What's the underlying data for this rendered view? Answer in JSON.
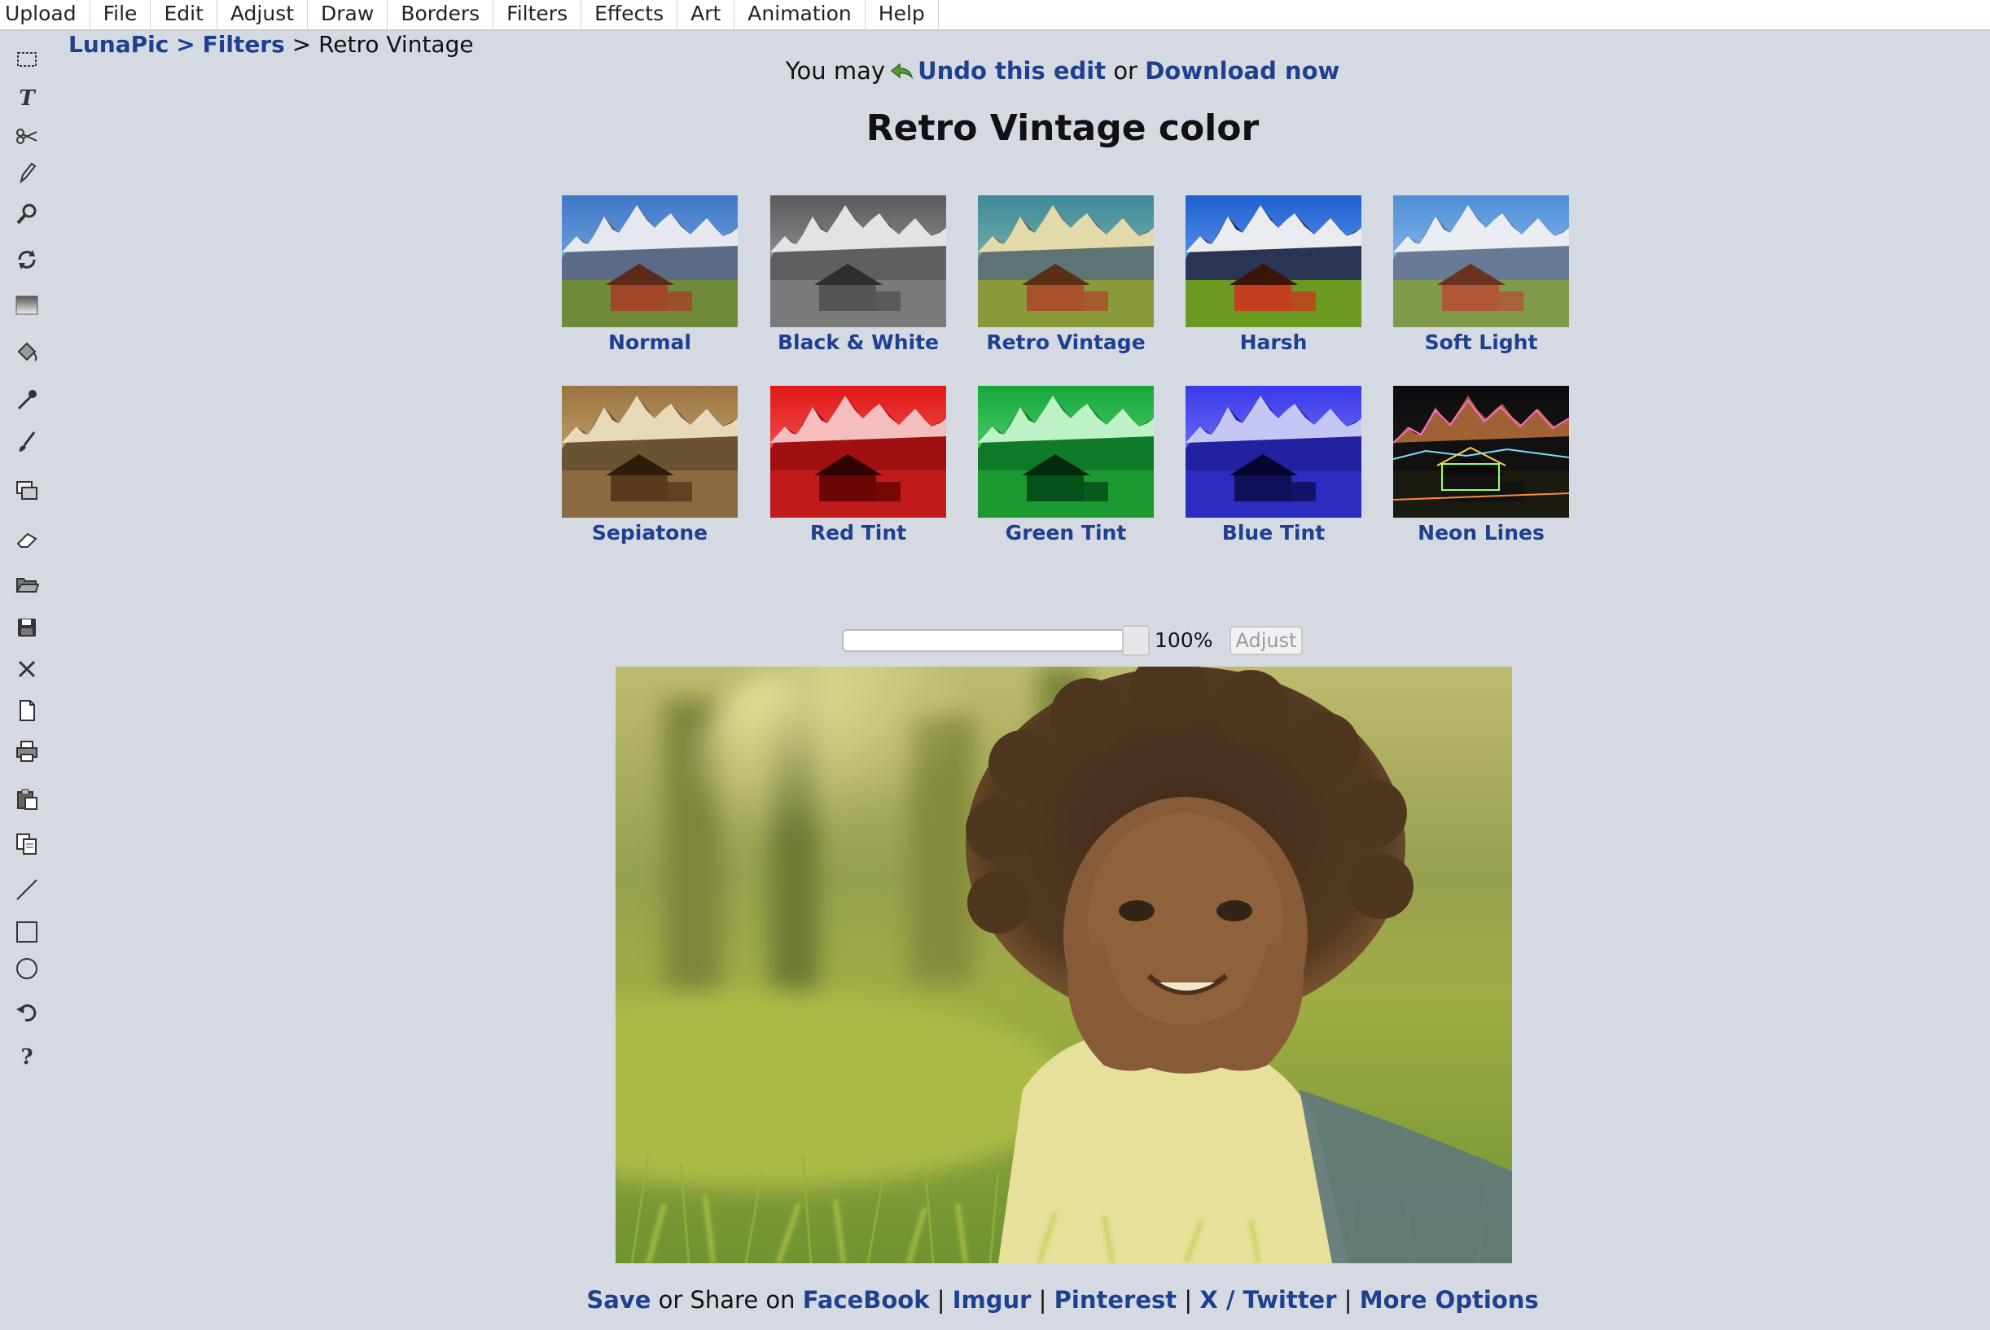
{
  "menu": [
    "Upload",
    "File",
    "Edit",
    "Adjust",
    "Draw",
    "Borders",
    "Filters",
    "Effects",
    "Art",
    "Animation",
    "Help"
  ],
  "toolbar": [
    {
      "name": "marquee-select-icon"
    },
    {
      "name": "text-tool-icon"
    },
    {
      "name": "scissors-icon"
    },
    {
      "name": "pencil-icon"
    },
    {
      "name": "magnifier-icon"
    },
    {
      "name": "rotate-icon"
    },
    {
      "name": "gradient-icon"
    },
    {
      "name": "paint-bucket-icon"
    },
    {
      "name": "eyedropper-icon"
    },
    {
      "name": "brush-icon"
    },
    {
      "name": "layers-icon"
    },
    {
      "name": "eraser-icon"
    },
    {
      "name": "open-folder-icon"
    },
    {
      "name": "save-disk-icon"
    },
    {
      "name": "close-x-icon"
    },
    {
      "name": "new-document-icon"
    },
    {
      "name": "printer-icon"
    },
    {
      "name": "paste-icon"
    },
    {
      "name": "copy-icon"
    },
    {
      "name": "line-tool-icon"
    },
    {
      "name": "rectangle-tool-icon"
    },
    {
      "name": "circle-tool-icon"
    },
    {
      "name": "undo-arrow-icon"
    },
    {
      "name": "help-question-icon"
    }
  ],
  "breadcrumb": {
    "root": "LunaPic",
    "sep": ">",
    "section": "Filters",
    "current": "Retro Vintage"
  },
  "undo_line": {
    "prefix": "You may",
    "undo": "Undo this edit",
    "or": "or",
    "download": "Download now"
  },
  "title": "Retro Vintage color",
  "filters": [
    {
      "label": "Normal",
      "tint": "normal"
    },
    {
      "label": "Black & White",
      "tint": "bw"
    },
    {
      "label": "Retro Vintage",
      "tint": "retro"
    },
    {
      "label": "Harsh",
      "tint": "harsh"
    },
    {
      "label": "Soft Light",
      "tint": "soft"
    },
    {
      "label": "Sepiatone",
      "tint": "sepia"
    },
    {
      "label": "Red Tint",
      "tint": "red"
    },
    {
      "label": "Green Tint",
      "tint": "green"
    },
    {
      "label": "Blue Tint",
      "tint": "blue"
    },
    {
      "label": "Neon Lines",
      "tint": "neon"
    }
  ],
  "slider": {
    "value_label": "100%",
    "value": 1.0,
    "adjust_label": "Adjust"
  },
  "share_line": {
    "save": "Save",
    "middle": "or Share on",
    "links": [
      "FaceBook",
      "Imgur",
      "Pinterest",
      "X / Twitter",
      "More Options"
    ],
    "sep": "|"
  },
  "colors": {
    "link": "#1f3f8f",
    "background": "#d5dae2"
  }
}
